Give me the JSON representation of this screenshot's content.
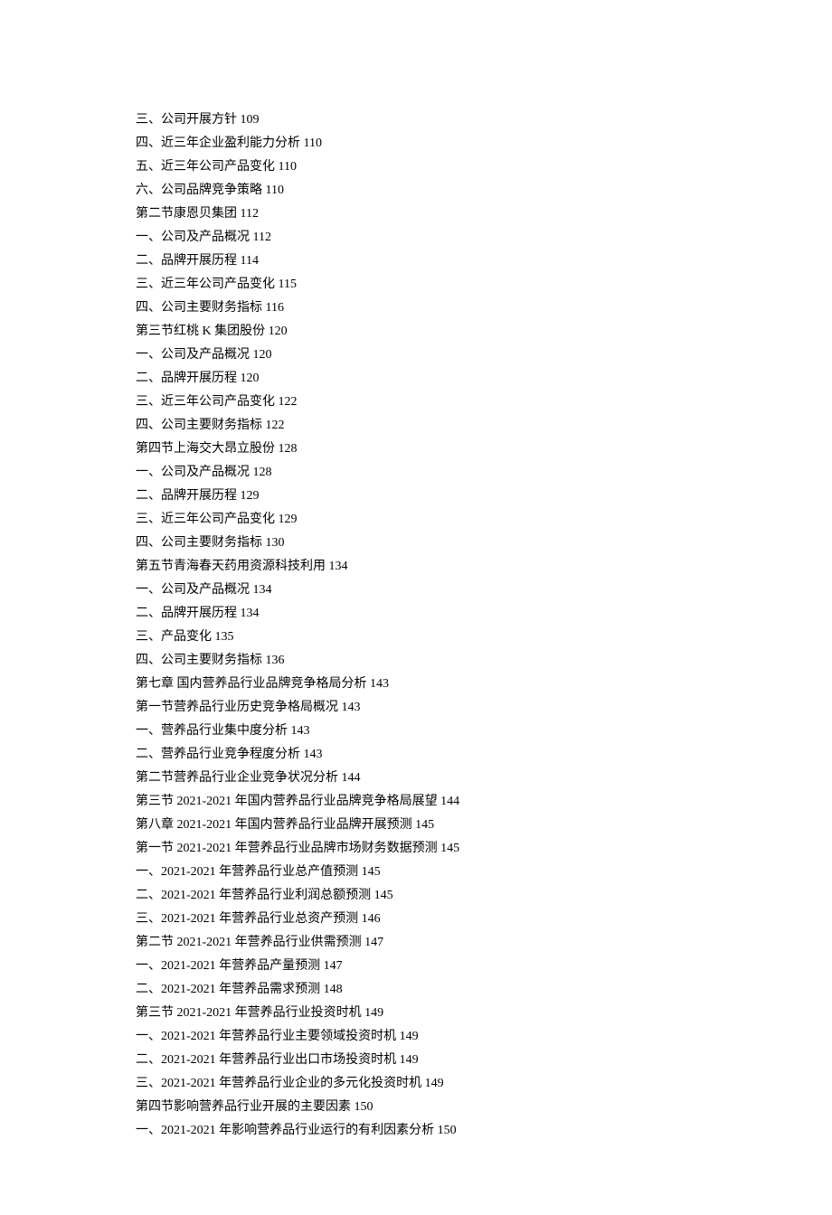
{
  "toc": [
    {
      "text": "三、公司开展方针",
      "page": "109"
    },
    {
      "text": "四、近三年企业盈利能力分析",
      "page": "110"
    },
    {
      "text": "五、近三年公司产品变化",
      "page": "110"
    },
    {
      "text": "六、公司品牌竞争策略",
      "page": "110"
    },
    {
      "text": "第二节康恩贝集团",
      "page": "112"
    },
    {
      "text": "一、公司及产品概况",
      "page": "112"
    },
    {
      "text": "二、品牌开展历程",
      "page": "114"
    },
    {
      "text": "三、近三年公司产品变化",
      "page": "115"
    },
    {
      "text": "四、公司主要财务指标",
      "page": "116"
    },
    {
      "text": "第三节红桃 K 集团股份",
      "page": "120"
    },
    {
      "text": "一、公司及产品概况",
      "page": "120"
    },
    {
      "text": "二、品牌开展历程",
      "page": "120"
    },
    {
      "text": "三、近三年公司产品变化",
      "page": "122"
    },
    {
      "text": "四、公司主要财务指标",
      "page": "122"
    },
    {
      "text": "第四节上海交大昂立股份",
      "page": "128"
    },
    {
      "text": "一、公司及产品概况",
      "page": "128"
    },
    {
      "text": "二、品牌开展历程",
      "page": "129"
    },
    {
      "text": "三、近三年公司产品变化",
      "page": "129"
    },
    {
      "text": "四、公司主要财务指标",
      "page": "130"
    },
    {
      "text": "第五节青海春天药用资源科技利用",
      "page": "134"
    },
    {
      "text": "一、公司及产品概况",
      "page": "134"
    },
    {
      "text": "二、品牌开展历程",
      "page": "134"
    },
    {
      "text": "三、产品变化",
      "page": "135"
    },
    {
      "text": "四、公司主要财务指标",
      "page": "136"
    },
    {
      "text": "第七章 国内营养品行业品牌竞争格局分析",
      "page": "143"
    },
    {
      "text": "第一节营养品行业历史竞争格局概况",
      "page": "143"
    },
    {
      "text": "一、营养品行业集中度分析",
      "page": "143"
    },
    {
      "text": "二、营养品行业竞争程度分析",
      "page": "143"
    },
    {
      "text": "第二节营养品行业企业竞争状况分析",
      "page": "144"
    },
    {
      "text": "第三节 2021-2021 年国内营养品行业品牌竞争格局展望",
      "page": "144"
    },
    {
      "text": "第八章 2021-2021 年国内营养品行业品牌开展预测",
      "page": "145"
    },
    {
      "text": "第一节 2021-2021 年营养品行业品牌市场财务数据预测",
      "page": "145"
    },
    {
      "text": "一、2021-2021 年营养品行业总产值预测",
      "page": "145"
    },
    {
      "text": "二、2021-2021 年营养品行业利润总额预测",
      "page": "145"
    },
    {
      "text": "三、2021-2021 年营养品行业总资产预测",
      "page": "146"
    },
    {
      "text": "第二节 2021-2021 年营养品行业供需预测",
      "page": "147"
    },
    {
      "text": "一、2021-2021 年营养品产量预测",
      "page": "147"
    },
    {
      "text": "二、2021-2021 年营养品需求预测",
      "page": "148"
    },
    {
      "text": "第三节 2021-2021 年营养品行业投资时机",
      "page": "149"
    },
    {
      "text": "一、2021-2021 年营养品行业主要领域投资时机",
      "page": "149"
    },
    {
      "text": "二、2021-2021 年营养品行业出口市场投资时机",
      "page": "149"
    },
    {
      "text": "三、2021-2021 年营养品行业企业的多元化投资时机",
      "page": "149"
    },
    {
      "text": "第四节影响营养品行业开展的主要因素",
      "page": "150"
    },
    {
      "text": "一、2021-2021 年影响营养品行业运行的有利因素分析",
      "page": "150"
    }
  ]
}
